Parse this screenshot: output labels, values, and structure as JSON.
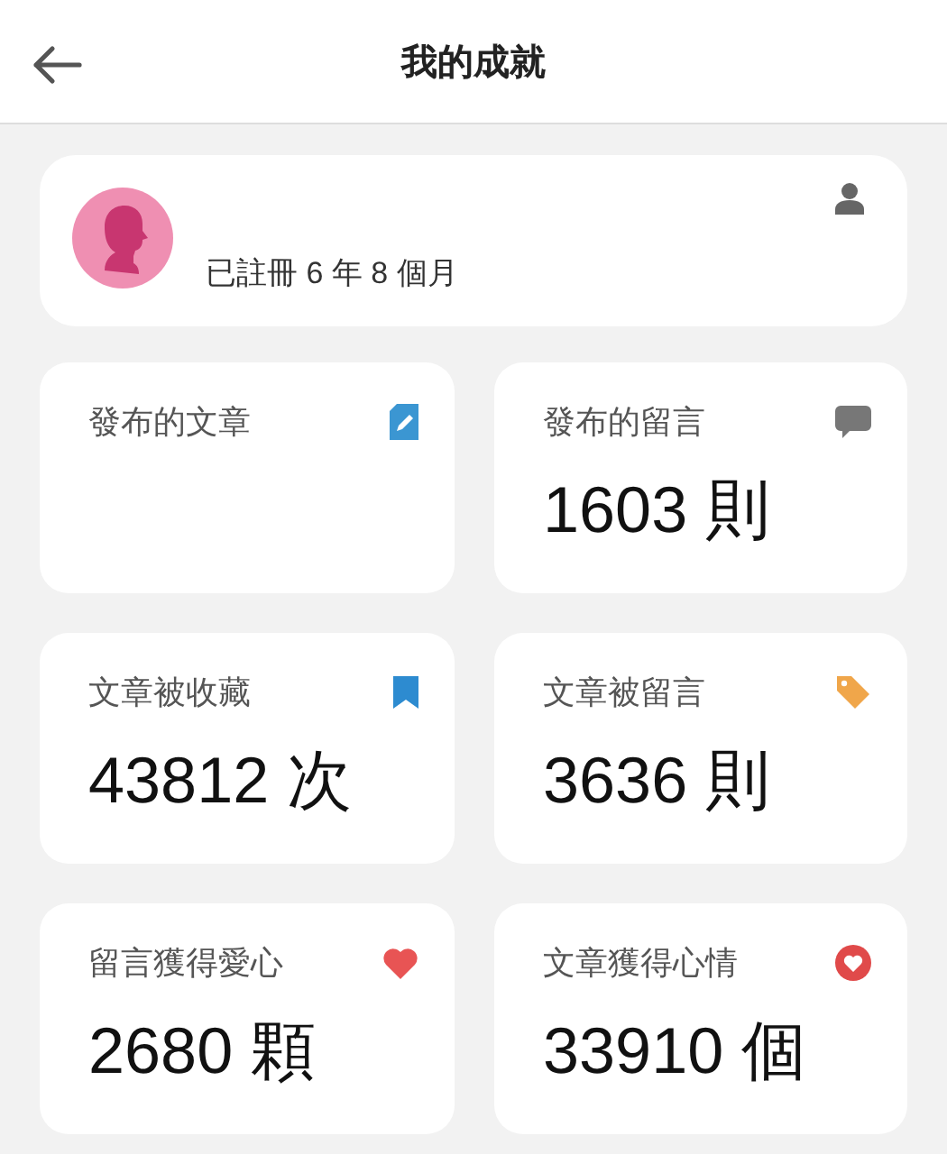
{
  "header": {
    "title": "我的成就"
  },
  "profile": {
    "registered": "已註冊 6 年 8 個月"
  },
  "stats": [
    {
      "label": "發布的文章",
      "kind": "article"
    },
    {
      "label": "發布的留言",
      "value": "1603 則",
      "kind": "comment"
    },
    {
      "label": "文章被收藏",
      "value": "43812 次",
      "kind": "bookmark"
    },
    {
      "label": "文章被留言",
      "value": "3636 則",
      "kind": "tag"
    },
    {
      "label": "留言獲得愛心",
      "value": "2680 顆",
      "kind": "heart"
    },
    {
      "label": "文章獲得心情",
      "value": "33910 個",
      "kind": "heart-circle"
    }
  ]
}
